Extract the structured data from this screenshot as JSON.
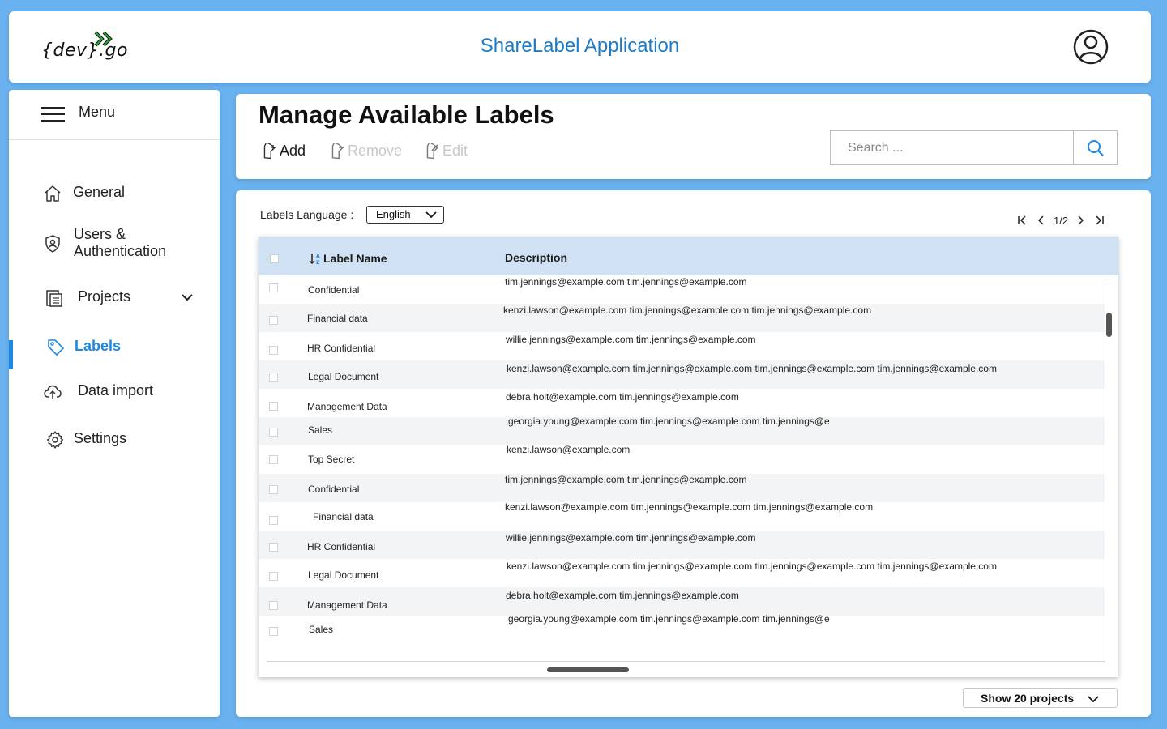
{
  "header": {
    "logo_text": "{dev}.go",
    "app_title": "ShareLabel Application"
  },
  "sidebar": {
    "menu_label": "Menu",
    "items": [
      {
        "label": "General",
        "icon": "home-icon"
      },
      {
        "label": "Users & Authentication",
        "icon": "shield-user-icon"
      },
      {
        "label": "Projects",
        "icon": "projects-icon"
      },
      {
        "label": "Labels",
        "icon": "tag-icon",
        "active": true
      },
      {
        "label": "Data import",
        "icon": "cloud-upload-icon"
      },
      {
        "label": "Settings",
        "icon": "gear-icon"
      }
    ]
  },
  "page": {
    "title": "Manage Available Labels",
    "toolbar": {
      "add_label": "Add",
      "remove_label": "Remove",
      "edit_label": "Edit"
    },
    "search": {
      "placeholder": "Search ...",
      "value": ""
    }
  },
  "labels_language": {
    "label": "Labels Language :",
    "selected": "English"
  },
  "pagination": {
    "current": "1/2"
  },
  "table": {
    "columns": [
      "Label Name",
      "Description"
    ],
    "rows": [
      {
        "name": "Confidential",
        "description": "tim.jennings@example.com tim.jennings@example.com"
      },
      {
        "name": "Financial data",
        "description": "kenzi.lawson@example.com tim.jennings@example.com tim.jennings@example.com"
      },
      {
        "name": "HR Confidential",
        "description": "willie.jennings@example.com tim.jennings@example.com"
      },
      {
        "name": "Legal Document",
        "description": "kenzi.lawson@example.com tim.jennings@example.com tim.jennings@example.com tim.jennings@example.com"
      },
      {
        "name": "Management Data",
        "description": "debra.holt@example.com tim.jennings@example.com"
      },
      {
        "name": "Sales",
        "description": "georgia.young@example.com tim.jennings@example.com tim.jennings@e"
      },
      {
        "name": "Top Secret",
        "description": "kenzi.lawson@example.com"
      },
      {
        "name": "Confidential",
        "description": "tim.jennings@example.com tim.jennings@example.com"
      },
      {
        "name": "Financial data",
        "description": "kenzi.lawson@example.com tim.jennings@example.com tim.jennings@example.com"
      },
      {
        "name": "HR Confidential",
        "description": "willie.jennings@example.com tim.jennings@example.com"
      },
      {
        "name": "Legal Document",
        "description": "kenzi.lawson@example.com tim.jennings@example.com tim.jennings@example.com tim.jennings@example.com"
      },
      {
        "name": "Management Data",
        "description": "debra.holt@example.com tim.jennings@example.com"
      },
      {
        "name": "Sales",
        "description": "georgia.young@example.com tim.jennings@example.com tim.jennings@e"
      }
    ]
  },
  "footer": {
    "show_select": "Show 20 projects"
  },
  "colors": {
    "background": "#6ab2ef",
    "accent": "#1e88e5",
    "title_blue": "#1e7bc6",
    "table_header": "#cfe1f3",
    "logo_green": "#2aa836"
  }
}
